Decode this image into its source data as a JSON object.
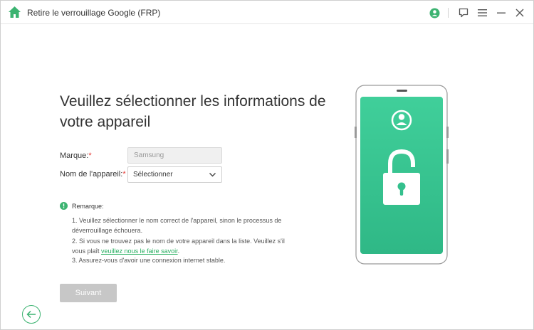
{
  "window": {
    "title": "Retire le verrouillage Google (FRP)"
  },
  "titlebar": {
    "icons": [
      "home-icon",
      "user-account-icon",
      "feedback-icon",
      "menu-icon",
      "minimize-icon",
      "close-icon"
    ]
  },
  "main": {
    "heading": "Veuillez sélectionner les informations de votre appareil",
    "brand_label": "Marque:",
    "brand_value": "Samsung",
    "device_label": "Nom de l'appareil:",
    "device_value": "Sélectionner",
    "required_mark": "*"
  },
  "note": {
    "title": "Remarque:",
    "line1": "1. Veuillez sélectionner le nom correct de l'appareil, sinon le processus de déverrouillage échouera.",
    "line2_prefix": "2. Si vous ne trouvez pas le nom de votre appareil dans la liste. Veuillez s'il vous plaît ",
    "line2_link": "veuillez nous le faire savoir",
    "line2_suffix": ".",
    "line3": "3. Assurez-vous d'avoir une connexion internet stable."
  },
  "actions": {
    "next_label": "Suivant"
  },
  "colors": {
    "accent": "#3cb371",
    "phone_screen_top": "#40cf9a",
    "phone_screen_bottom": "#2fb886",
    "button_disabled": "#c7c7c7",
    "required": "#e53935"
  }
}
